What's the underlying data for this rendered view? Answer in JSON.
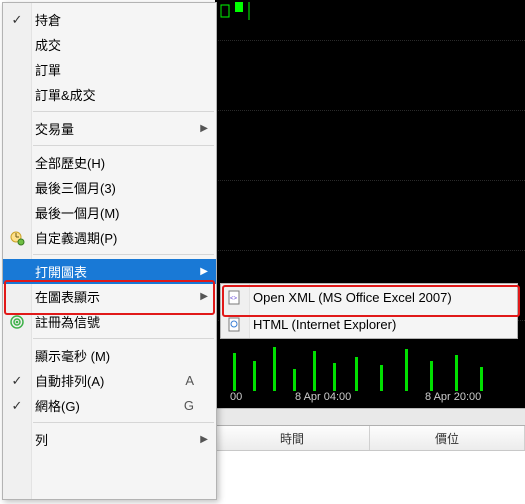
{
  "menu": {
    "items": [
      {
        "label": "持倉",
        "checked": true
      },
      {
        "label": "成交"
      },
      {
        "label": "訂單"
      },
      {
        "label": "訂單&成交"
      },
      {
        "sep": true
      },
      {
        "label": "交易量",
        "submenu": true
      },
      {
        "sep": true
      },
      {
        "label": "全部歷史(H)"
      },
      {
        "label": "最後三個月(3)"
      },
      {
        "label": "最後一個月(M)"
      },
      {
        "label": "自定義週期(P)",
        "icon": "clock-gear-icon"
      },
      {
        "sep": true
      },
      {
        "label": "打開圖表",
        "submenu": true,
        "highlighted": true
      },
      {
        "label": "在圖表顯示",
        "submenu": true
      },
      {
        "label": "註冊為信號",
        "icon": "signal-icon"
      },
      {
        "sep": true
      },
      {
        "label": "顯示毫秒 (M)"
      },
      {
        "label": "自動排列(A)",
        "checked": true,
        "shortcut": "A"
      },
      {
        "label": "網格(G)",
        "checked": true,
        "shortcut": "G"
      },
      {
        "sep": true
      },
      {
        "label": "列",
        "submenu": true
      }
    ]
  },
  "submenu": {
    "items": [
      {
        "label": "Open XML (MS Office Excel 2007)",
        "icon": "xml-file-icon"
      },
      {
        "label": "HTML (Internet Explorer)",
        "icon": "html-file-icon"
      }
    ]
  },
  "chart": {
    "axis_labels": [
      "00",
      "8 Apr 04:00",
      "8 Apr 20:00"
    ]
  },
  "table": {
    "headers": [
      "時間",
      "價位"
    ]
  }
}
